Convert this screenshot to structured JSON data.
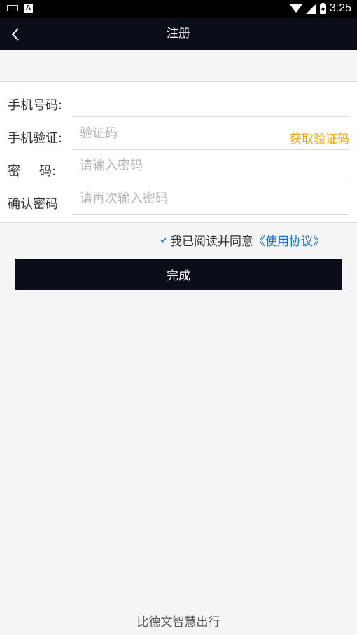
{
  "status_bar": {
    "time": "3:25",
    "icons": [
      "keyboard-icon",
      "a-icon",
      "wifi-icon",
      "signal-icon",
      "battery-icon"
    ]
  },
  "nav": {
    "title": "注册",
    "back_icon": "chevron-left-icon"
  },
  "form": {
    "phone": {
      "label": "手机号码:",
      "value": "",
      "placeholder": ""
    },
    "verify": {
      "label": "手机验证:",
      "placeholder": "验证码",
      "get_code_label": "获取验证码"
    },
    "password": {
      "label_first": "密",
      "label_second": "码:",
      "placeholder": "请输入密码"
    },
    "confirm": {
      "label": "确认密码",
      "placeholder": "请再次输入密码"
    }
  },
  "agreement": {
    "checked": true,
    "text": "我已阅读并同意",
    "link": "《使用协议》"
  },
  "submit_label": "完成",
  "footer": "比德文智慧出行",
  "colors": {
    "nav_bg": "#0a0e19",
    "accent_orange": "#f0a30a",
    "link_blue": "#1a6fd6",
    "page_bg": "#f5f5f5"
  }
}
